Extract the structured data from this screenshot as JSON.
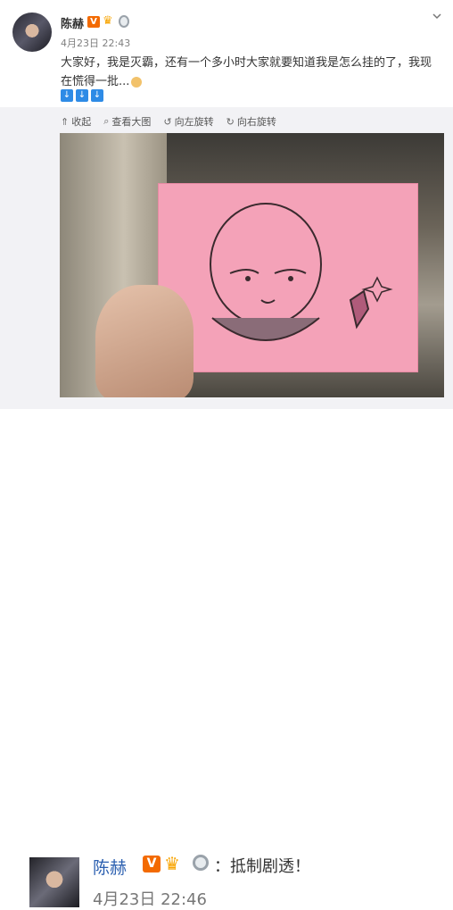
{
  "post": {
    "author": "陈赫",
    "time": "4月23日 22:43",
    "text": "大家好，我是灭霸，还有一个多小时大家就要知道我是怎么挂的了，我现在慌得一批...",
    "arrows": [
      "↓",
      "↓",
      "↓"
    ]
  },
  "media_toolbar": {
    "collapse": "收起",
    "view_large": "查看大图",
    "rotate_left": "向左旋转",
    "rotate_right": "向右旋转"
  },
  "reply": {
    "author": "陈赫",
    "comment": "：抵制剧透！",
    "time": "4月23日 22:46"
  },
  "colors": {
    "link_blue": "#2b5fb0",
    "verified_orange": "#f36a00",
    "crown_gold": "#f8a400"
  }
}
